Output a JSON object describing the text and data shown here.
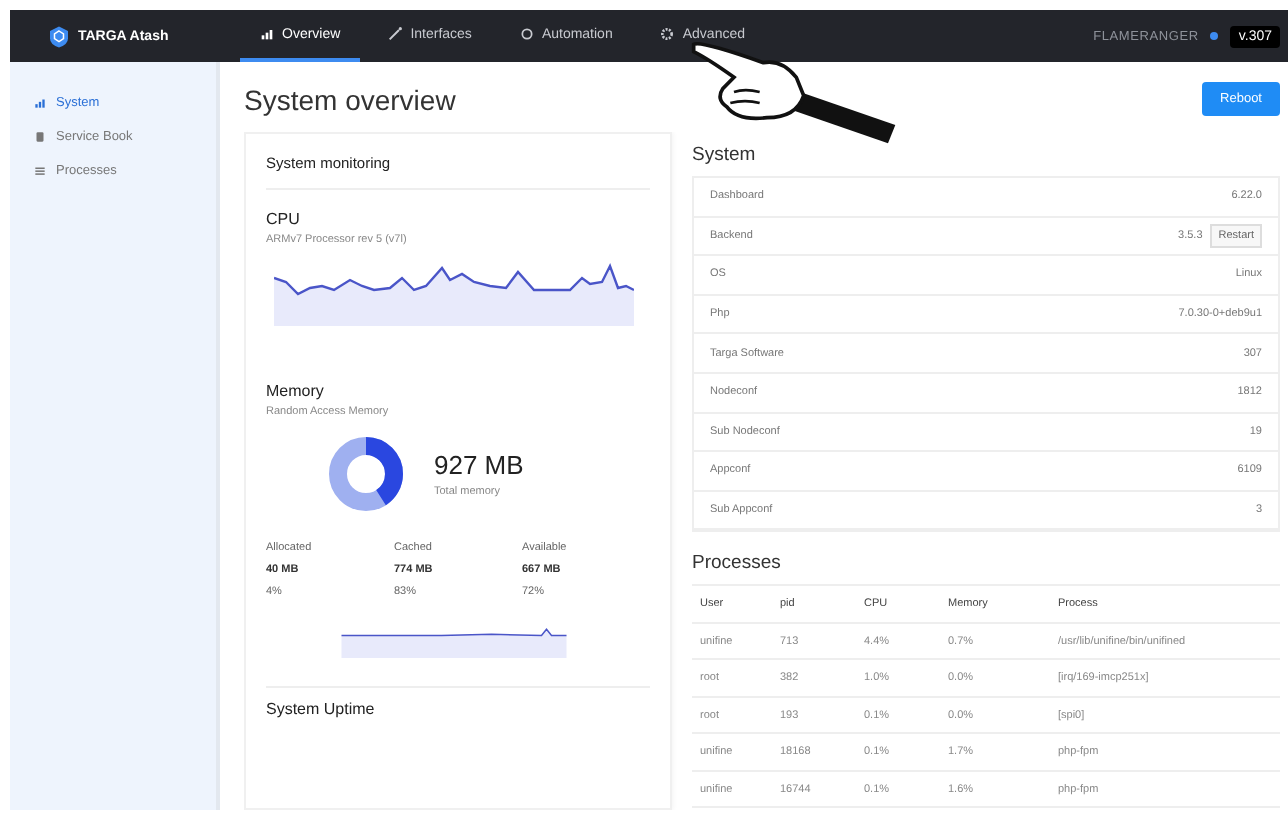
{
  "nav": {
    "brand": "TARGA Atash",
    "tabs": [
      {
        "label": "Overview",
        "selected": true
      },
      {
        "label": "Interfaces",
        "selected": false
      },
      {
        "label": "Automation",
        "selected": false
      },
      {
        "label": "Advanced",
        "selected": false
      }
    ],
    "user": "FLAMERANGER",
    "version": "v.307"
  },
  "sidebar": {
    "items": [
      {
        "label": "System",
        "selected": true
      },
      {
        "label": "Service Book",
        "selected": false
      },
      {
        "label": "Processes",
        "selected": false
      }
    ]
  },
  "page": {
    "title": "System overview",
    "button": "Reboot"
  },
  "monitoring": {
    "title": "System monitoring",
    "cpu": {
      "title": "CPU",
      "subtitle": "ARMv7 Processor rev 5 (v7l)"
    },
    "memory": {
      "title": "Memory",
      "subtitle": "Random Access Memory",
      "total": "927 MB",
      "total_label": "Total memory",
      "stats": [
        {
          "label": "Allocated",
          "value": "40 MB",
          "percent": "4%"
        },
        {
          "label": "Cached",
          "value": "774 MB",
          "percent": "83%"
        },
        {
          "label": "Available",
          "value": "667 MB",
          "percent": "72%"
        }
      ]
    },
    "uptime_title": "System Uptime"
  },
  "system": {
    "title": "System",
    "rows": [
      {
        "label": "Dashboard",
        "value": "6.22.0"
      },
      {
        "label": "Backend",
        "value": "3.5.3",
        "action": "Restart"
      },
      {
        "label": "OS",
        "value": "Linux"
      },
      {
        "label": "Php",
        "value": "7.0.30-0+deb9u1"
      },
      {
        "label": "Targa Software",
        "value": "307"
      },
      {
        "label": "Nodeconf",
        "value": "1812"
      },
      {
        "label": "Sub Nodeconf",
        "value": "19"
      },
      {
        "label": "Appconf",
        "value": "6109"
      },
      {
        "label": "Sub Appconf",
        "value": "3"
      }
    ]
  },
  "processes": {
    "title": "Processes",
    "columns": [
      "User",
      "pid",
      "CPU",
      "Memory",
      "Process"
    ],
    "rows": [
      [
        "unifine",
        "713",
        "4.4%",
        "0.7%",
        "/usr/lib/unifine/bin/unifined"
      ],
      [
        "root",
        "382",
        "1.0%",
        "0.0%",
        "[irq/169-imcp251x]"
      ],
      [
        "root",
        "193",
        "0.1%",
        "0.0%",
        "[spi0]"
      ],
      [
        "unifine",
        "18168",
        "0.1%",
        "1.7%",
        "php-fpm"
      ],
      [
        "unifine",
        "16744",
        "0.1%",
        "1.6%",
        "php-fpm"
      ]
    ]
  }
}
